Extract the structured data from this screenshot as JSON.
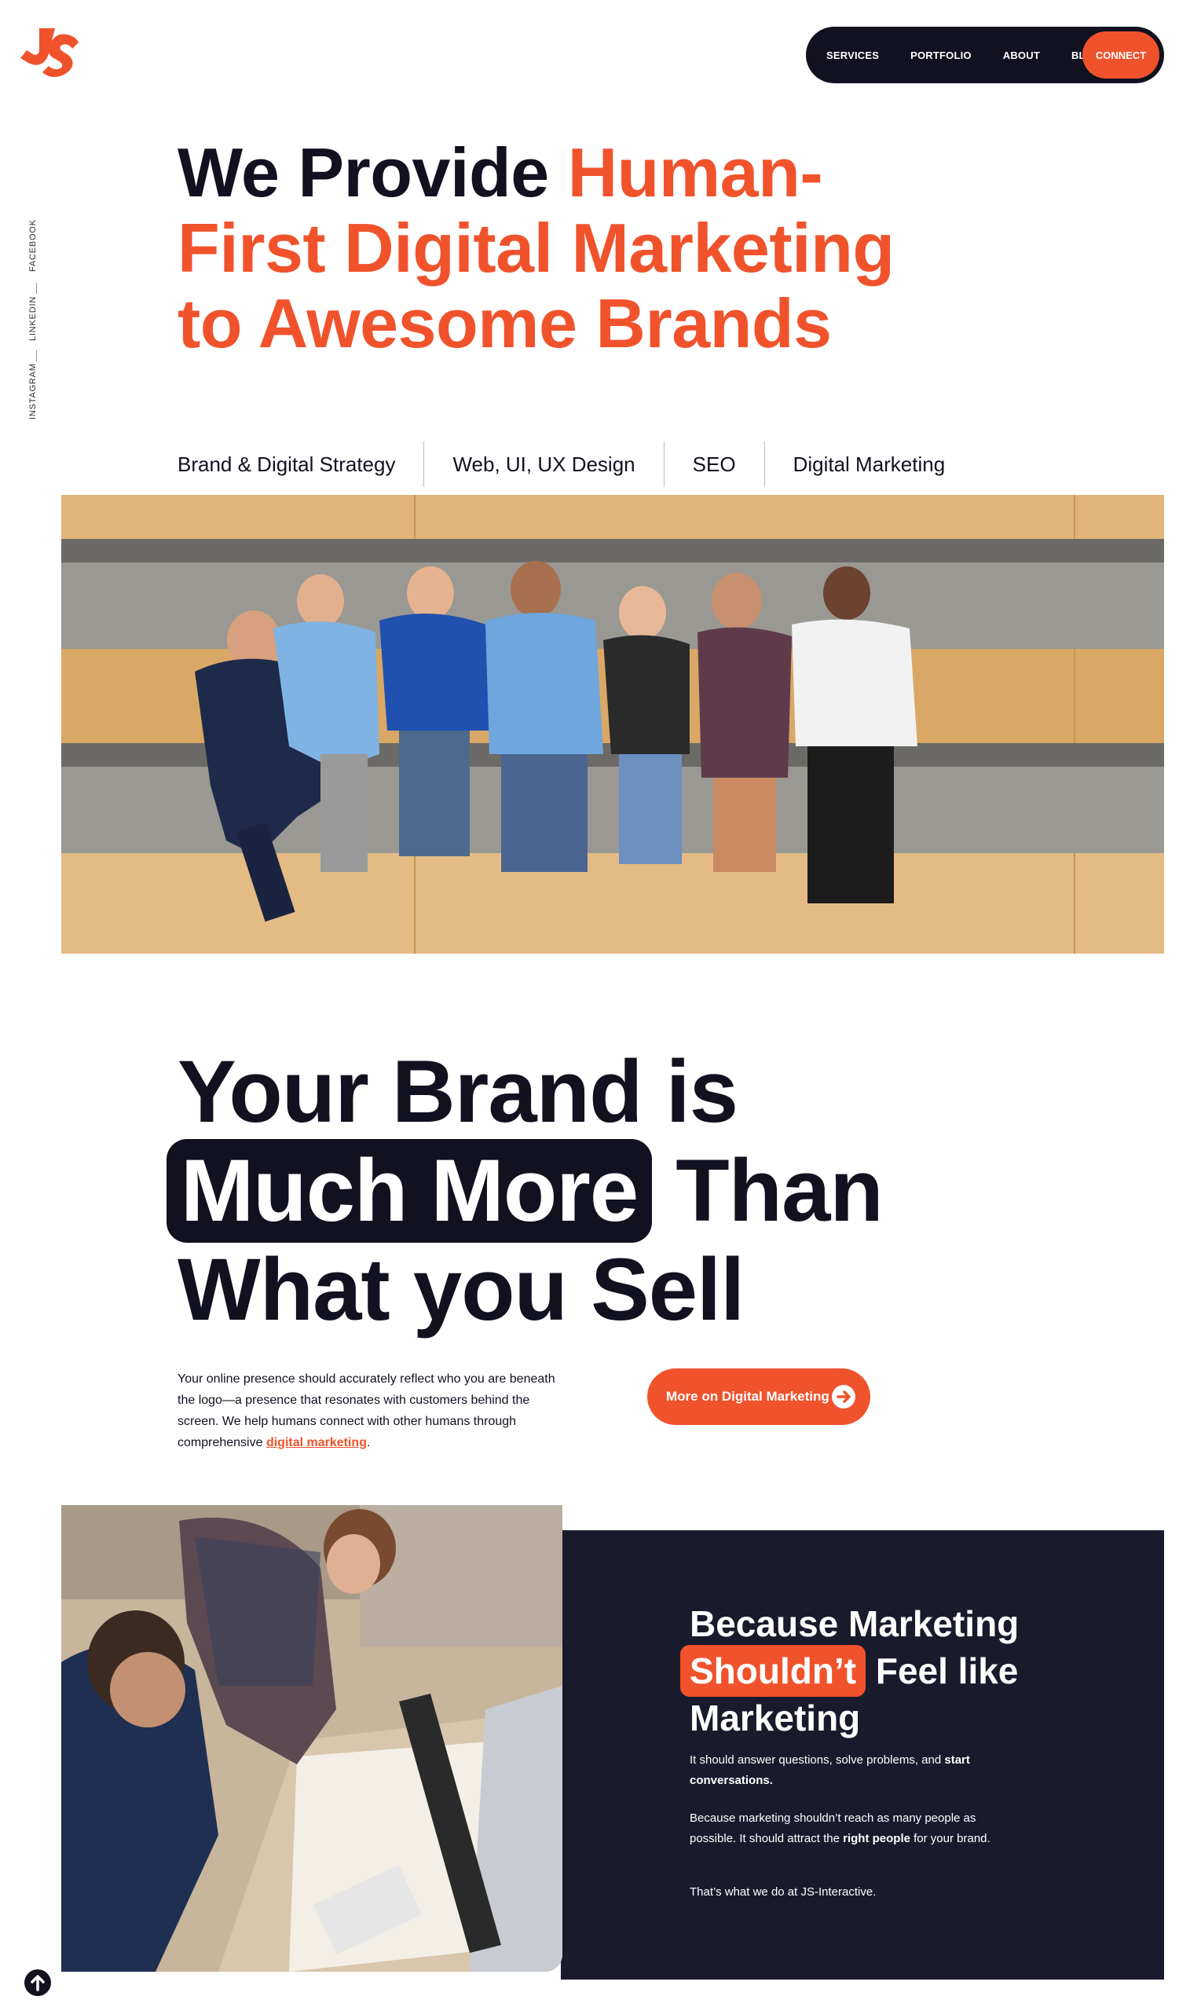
{
  "header": {
    "logo_icon": "js-interactive-logo",
    "nav": {
      "services": "SERVICES",
      "portfolio": "PORTFOLIO",
      "about": "ABOUT",
      "blog": "BLOG",
      "connect": "CONNECT"
    }
  },
  "social": {
    "facebook": "FACEBOOK",
    "linkedin": "LINKEDIN",
    "instagram": "INSTAGRAM"
  },
  "hero": {
    "title_dark": "We Provide ",
    "title_accent_1": "Human-",
    "title_accent_2": "First Digital Marketing",
    "title_accent_3": "to Awesome Brands"
  },
  "services": [
    "Brand & Digital Strategy",
    "Web, UI, UX Design",
    "SEO",
    "Digital Marketing"
  ],
  "brand": {
    "line1": "Your Brand is",
    "highlight": "Much More",
    "line2_rest": " Than",
    "line3": "What you Sell",
    "text_before": "Your online presence should accurately reflect who you are beneath the logo—a presence that resonates with customers behind the screen. We help humans connect with other humans through comprehensive ",
    "text_link": "digital marketing",
    "text_after": ".",
    "cta": "More on Digital Marketing",
    "cta_icon": "arrow-right-circle-icon"
  },
  "marketing": {
    "title_line1": "Because Marketing",
    "title_highlight": "Shouldn’t",
    "title_line2_rest": " Feel like",
    "title_line3": "Marketing",
    "p1_before": "It should answer questions, solve problems, and ",
    "p1_bold": "start conversations.",
    "p2_before": "Because marketing shouldn’t reach as many people as possible. It should attract the ",
    "p2_bold": "right people",
    "p2_after": " for your brand.",
    "p3": "That’s what we do at JS-Interactive."
  },
  "scroll_top_icon": "arrow-up-circle-icon",
  "colors": {
    "accent": "#f0532c",
    "dark": "#11111f",
    "panel": "#191b2c"
  }
}
